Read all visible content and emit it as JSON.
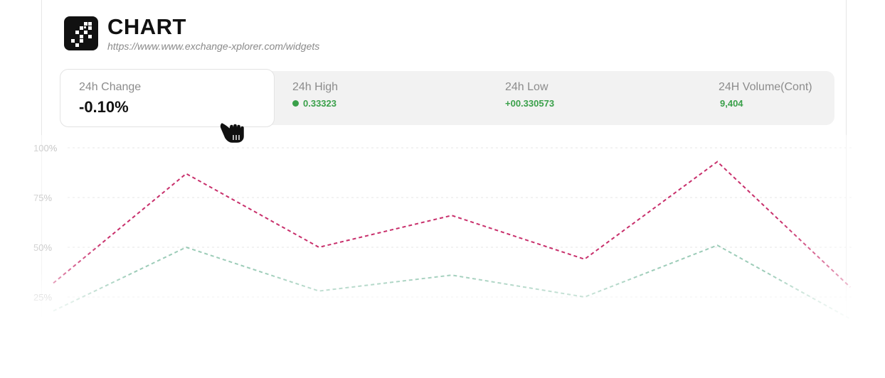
{
  "header": {
    "title": "CHART",
    "url": "https://www.www.exchange-xplorer.com/widgets"
  },
  "stats": [
    {
      "label": "24h Change",
      "value": "-0.10%"
    },
    {
      "label": "24h High",
      "value": "0.33323"
    },
    {
      "label": "24h Low",
      "value": "+00.330573"
    },
    {
      "label": "24H Volume(Cont)",
      "value": "9,404"
    }
  ],
  "colors": {
    "positive": "#3aa04a",
    "series_red": "#c2185b",
    "series_green": "#5aaa88"
  },
  "chart_data": {
    "type": "line",
    "x": [
      0,
      1,
      2,
      3,
      4,
      5,
      6
    ],
    "ylim": [
      25,
      100
    ],
    "yticks": [
      "100%",
      "75%",
      "50%",
      "25%"
    ],
    "ytick_values": [
      100,
      75,
      50,
      25
    ],
    "grid": true,
    "series": [
      {
        "color": "#c2185b",
        "values": [
          32,
          87,
          50,
          66,
          44,
          93,
          30
        ]
      },
      {
        "color": "#5aaa88",
        "values": [
          18,
          50,
          28,
          36,
          25,
          51,
          14
        ]
      }
    ]
  }
}
